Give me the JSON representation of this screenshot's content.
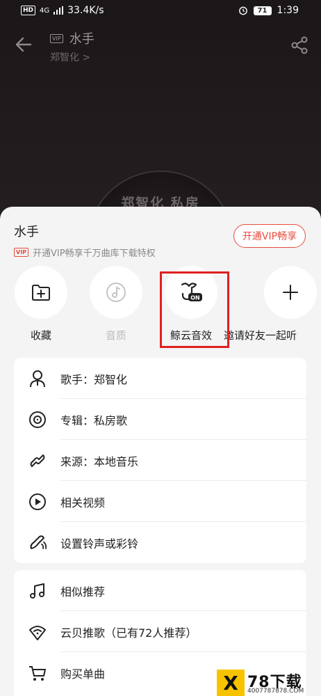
{
  "status_bar": {
    "hd": "HD",
    "signal": "4G",
    "speed": "33.4K/s",
    "battery": "71",
    "time": "1:39"
  },
  "player_header": {
    "vip_tag": "VIP",
    "song_title": "水手",
    "artist": "郑智化 >"
  },
  "disc_text": "郑智化 私房",
  "sheet": {
    "song_title": "水手",
    "vip_tag": "VIP",
    "promo": "开通VIP畅享千万曲库下载特权",
    "open_vip_button": "开通VIP畅享"
  },
  "actions": [
    {
      "label": "收藏",
      "icon": "add-folder-icon"
    },
    {
      "label": "音质",
      "icon": "quality-icon"
    },
    {
      "label": "鲸云音效",
      "icon": "whale-sound-effect-icon",
      "badge": "ON"
    },
    {
      "label": "邀请好友一起听",
      "icon": "plus-icon"
    }
  ],
  "info_items": [
    {
      "label": "歌手：郑智化",
      "icon": "singer-icon"
    },
    {
      "label": "专辑：私房歌",
      "icon": "album-icon"
    },
    {
      "label": "来源：本地音乐",
      "icon": "link-icon"
    },
    {
      "label": "相关视频",
      "icon": "video-icon"
    },
    {
      "label": "设置铃声或彩铃",
      "icon": "ringtone-icon"
    }
  ],
  "more_items": [
    {
      "label": "相似推荐",
      "icon": "music-notes-icon"
    },
    {
      "label": "云贝推歌（已有72人推荐）",
      "icon": "cloud-shell-icon"
    },
    {
      "label": "购买单曲",
      "icon": "cart-icon"
    }
  ],
  "watermark": {
    "logo": "X",
    "brand": "78下载",
    "url": "4007787878.COM"
  },
  "colors": {
    "accent": "#e74c3c",
    "highlight": "#e02020",
    "sheet_bg": "#f4f4f5"
  }
}
